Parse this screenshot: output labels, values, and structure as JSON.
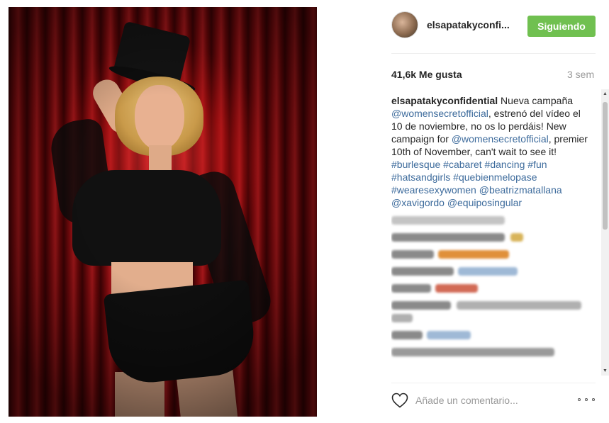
{
  "post": {
    "username": "elsapatakyconfi...",
    "follow_label": "Siguiendo",
    "likes": "41,6k Me gusta",
    "time_ago": "3 sem",
    "caption": {
      "user": "elsapatakyconfidential",
      "t1": " Nueva campaña ",
      "tag1": "@womensecretofficial",
      "t2": ", estrenó del vídeo el 10 de noviembre, no os lo perdáis! New campaign for ",
      "tag2": "@womensecretofficial",
      "t3": ", premier 10th of November, can't wait to see it! ",
      "tags": [
        "#burlesque",
        "#cabaret",
        "#dancing",
        "#fun",
        "#hatsandgirls",
        "#quebienmelopase",
        "#wearesexywomen",
        "@beatrizmatallana",
        "@xavigordo",
        "@equiposingular"
      ]
    },
    "comment_placeholder": "Añade un comentario...",
    "accent_color": "#70c050",
    "link_color": "#3d6b9c"
  },
  "icons": {
    "like": "heart-icon",
    "options": "more-options-icon",
    "scroll_up": "scroll-up-arrow-icon",
    "scroll_down": "scroll-down-arrow-icon"
  }
}
